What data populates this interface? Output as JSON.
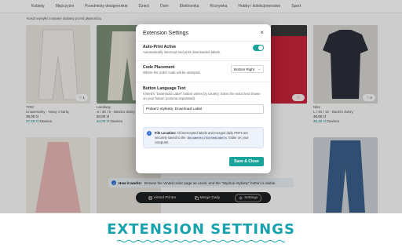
{
  "nav": {
    "categories": [
      "Kobiety",
      "Mężczyźni",
      "Przedmioty designerskie",
      "Dzieci",
      "Dom",
      "Elektronika",
      "Rozrywka",
      "Hobby i kolekcjonerstwo",
      "Sport"
    ]
  },
  "notice": "Koszt wysyłki zostanie dodany przed płatnością",
  "cards": [
    {
      "brand": "TOM",
      "meta": "Uniwersalny · Nowy z kartą",
      "price": "35,00 zł",
      "incl": "37,45 zł",
      "incl_label": "Zawiera",
      "likes": "1"
    },
    {
      "brand": "Landway",
      "meta": "S / 36 / 8 · Bardzo dobry",
      "price": "60,00 zł",
      "incl": "64,00 zł",
      "incl_label": "Zawiera",
      "likes": "3"
    },
    {
      "brand": "",
      "meta": "",
      "price": "",
      "incl": "",
      "incl_label": "",
      "likes": ""
    },
    {
      "brand": "",
      "meta": "",
      "price": "",
      "incl": "",
      "incl_label": "",
      "likes": ""
    },
    {
      "brand": "Nike",
      "meta": "L / 40 / 12 · Bardzo dobry",
      "price": "30,00 zł",
      "incl": "35,40 zł",
      "incl_label": "Zawiera",
      "likes": "2"
    }
  ],
  "how": {
    "label": "How it works:",
    "text": "Browse the Vinted order page as usual, and the \"Wydruk etykiety\" button is visible."
  },
  "toolbar": {
    "items": [
      {
        "label": "Vinted Printer",
        "icon": "printer-icon"
      },
      {
        "label": "Merge Daily",
        "icon": "merge-icon"
      },
      {
        "label": "Settings",
        "icon": "gear-icon"
      }
    ]
  },
  "modal": {
    "title": "Extension Settings",
    "auto_print": {
      "label": "Auto-Print Active",
      "sub": "Automatically intercept and print downloaded labels.",
      "enabled": true
    },
    "placement": {
      "label": "Code Placement",
      "sub": "Where the order code will be stamped.",
      "value": "Bottom Right"
    },
    "button_text": {
      "label": "Button Language Text",
      "sub": "Vinted's \"Download Label\" button varies by country. Enter the exact text shown on your button (comma separated).",
      "value": "Pobierz etykietę, Download Label"
    },
    "info": {
      "label": "File Location:",
      "text1": "All intercepted labels and merged daily PDFs are securely saved to the",
      "path": "Documents/VintedLabels",
      "text2": "folder on your computer."
    },
    "save_label": "Save & Close"
  },
  "banner": {
    "text": "EXTENSION SETTINGS"
  },
  "colors": {
    "accent": "#1aa39a",
    "banner": "#17a2ad",
    "info_blue": "#2f6fd6",
    "toolbar_bg": "#1e1f22"
  }
}
